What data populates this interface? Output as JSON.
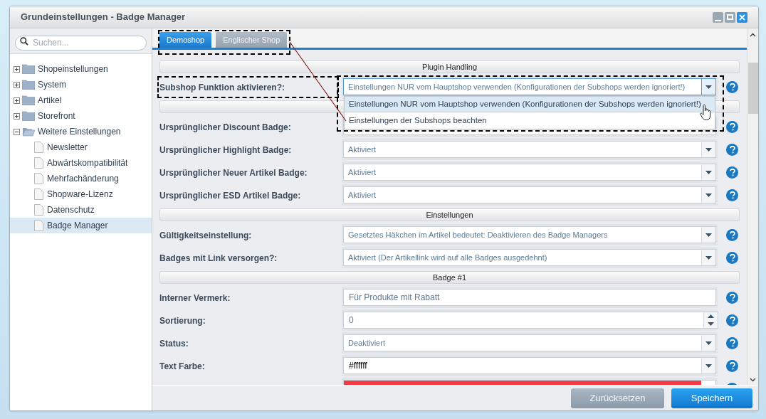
{
  "window": {
    "title": "Grundeinstellungen - Badge Manager"
  },
  "search": {
    "placeholder": "Suchen..."
  },
  "tree": [
    {
      "label": "Shopeinstellungen",
      "expanded": false,
      "selected": false
    },
    {
      "label": "System",
      "expanded": false,
      "selected": false
    },
    {
      "label": "Artikel",
      "expanded": false,
      "selected": false
    },
    {
      "label": "Storefront",
      "expanded": false,
      "selected": false
    },
    {
      "label": "Weitere Einstellungen",
      "expanded": true,
      "selected": false,
      "children": [
        {
          "label": "Newsletter",
          "selected": false
        },
        {
          "label": "Abwärtskompatibilität",
          "selected": false
        },
        {
          "label": "Mehrfachänderung",
          "selected": false
        },
        {
          "label": "Shopware-Lizenz",
          "selected": false
        },
        {
          "label": "Datenschutz",
          "selected": false
        },
        {
          "label": "Badge Manager",
          "selected": true
        }
      ]
    }
  ],
  "tabs": [
    {
      "label": "Demoshop",
      "selected": true
    },
    {
      "label": "Englischer Shop",
      "selected": false
    }
  ],
  "rows": [
    {
      "kind": "section",
      "title": "Plugin Handling"
    },
    {
      "kind": "select",
      "label": "Subshop Funktion aktivieren?:",
      "value": "Einstellungen NUR vom Hauptshop verwenden (Konfigurationen der Subshops werden ignoriert!)",
      "expanded": true,
      "options": [
        {
          "label": "Einstellungen NUR vom Hauptshop verwenden (Konfigurationen der Subshops werden ignoriert!)",
          "selected": true
        },
        {
          "label": "Einstellungen der Subshops beachten",
          "selected": false
        }
      ]
    },
    {
      "kind": "section"
    },
    {
      "kind": "select",
      "label": "Ursprünglicher Discount Badge:",
      "expanded": false
    },
    {
      "kind": "select",
      "label": "Ursprünglicher Highlight Badge:",
      "value": "Aktiviert",
      "expanded": false
    },
    {
      "kind": "select",
      "label": "Ursprünglicher Neuer Artikel Badge:",
      "value": "Aktiviert",
      "expanded": false
    },
    {
      "kind": "select",
      "label": "Ursprünglicher ESD Artikel Badge:",
      "value": "Aktiviert",
      "expanded": false
    },
    {
      "kind": "section",
      "title": "Einstellungen"
    },
    {
      "kind": "select",
      "label": "Gültigkeitseinstellung:",
      "value": "Gesetztes Häkchen im Artikel bedeutet: Deaktivieren des Badge Managers",
      "expanded": false
    },
    {
      "kind": "select",
      "label": "Badges mit Link versorgen?:",
      "value": "Aktiviert (Der Artikellink wird auf alle Badges ausgedehnt)",
      "expanded": false
    },
    {
      "kind": "section",
      "title": "Badge #1"
    },
    {
      "kind": "text",
      "label": "Interner Vermerk:",
      "value": "Für Produkte mit Rabatt"
    },
    {
      "kind": "number",
      "label": "Sortierung:",
      "value": "0"
    },
    {
      "kind": "select",
      "label": "Status:",
      "value": "Deaktiviert",
      "expanded": false
    },
    {
      "kind": "colorpicker",
      "label": "Text Farbe:",
      "value": "#ffffff"
    },
    {
      "kind": "swatch",
      "color": "#ef3f45"
    }
  ],
  "buttons": [
    {
      "label": "Zurücksetzen",
      "kind": "secondary"
    },
    {
      "label": "Speichern",
      "kind": "primary"
    }
  ]
}
